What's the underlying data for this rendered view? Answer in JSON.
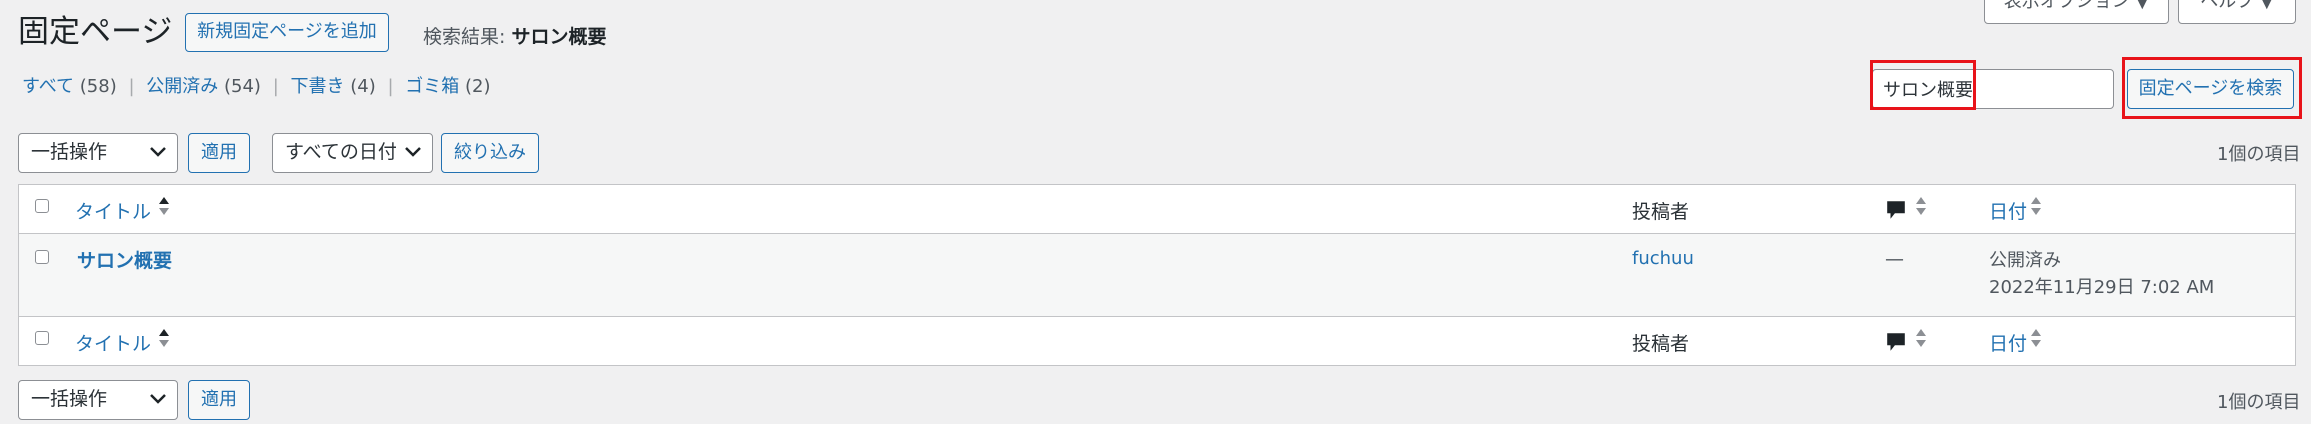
{
  "header": {
    "title": "固定ページ",
    "add_new_label": "新規固定ページを追加",
    "search_result_prefix": "検索結果: ",
    "search_result_term": "サロン概要",
    "screen_options_label": "表示オプション ▼",
    "help_label": "ヘルプ ▼"
  },
  "filters": [
    {
      "label": "すべて",
      "count": "(58)"
    },
    {
      "label": "公開済み",
      "count": "(54)"
    },
    {
      "label": "下書き",
      "count": "(4)"
    },
    {
      "label": "ゴミ箱",
      "count": "(2)"
    }
  ],
  "separator": "|",
  "search": {
    "value": "サロン概要",
    "button_label": "固定ページを検索"
  },
  "top_actions": {
    "bulk_select": "一括操作",
    "apply_label": "適用",
    "date_select": "すべての日付",
    "filter_label": "絞り込み",
    "item_count": "1個の項目"
  },
  "table": {
    "columns": {
      "title": "タイトル",
      "author": "投稿者",
      "date": "日付"
    },
    "rows": [
      {
        "title": "サロン概要",
        "author": "fuchuu",
        "comments": "—",
        "status": "公開済み",
        "date": "2022年11月29日 7:02 AM"
      }
    ]
  },
  "bottom_actions": {
    "bulk_select": "一括操作",
    "apply_label": "適用",
    "item_count": "1個の項目"
  },
  "colors": {
    "link": "#2271b1",
    "highlight": "#e8131a"
  }
}
